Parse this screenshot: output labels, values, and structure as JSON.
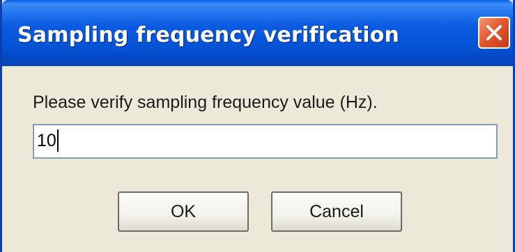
{
  "window": {
    "title": "Sampling frequency verification",
    "close_icon": "close-icon"
  },
  "dialog": {
    "prompt": "Please verify sampling frequency value (Hz).",
    "input_value": "10"
  },
  "buttons": {
    "ok_label": "OK",
    "cancel_label": "Cancel"
  },
  "colors": {
    "titlebar": "#0a59e0",
    "close_button": "#e25a2e",
    "dialog_background": "#ece9d8"
  }
}
